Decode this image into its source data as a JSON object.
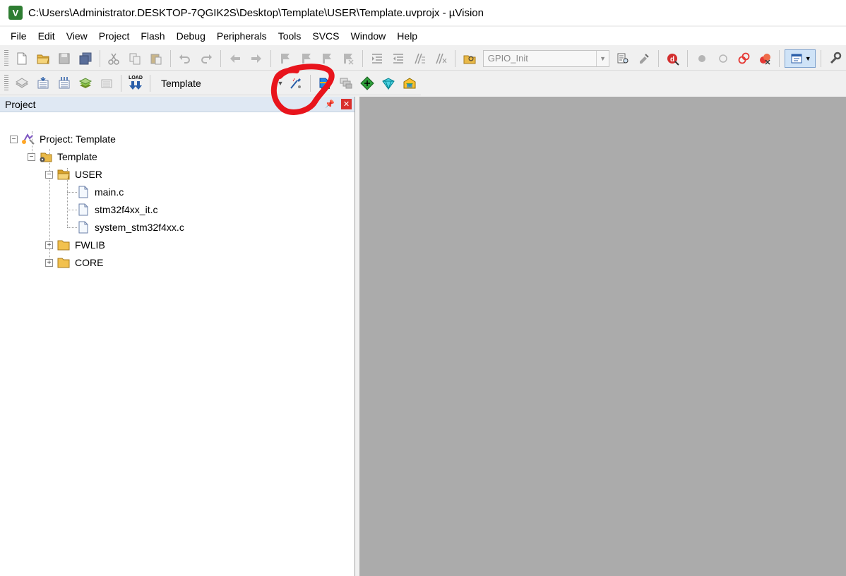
{
  "window": {
    "title": "C:\\Users\\Administrator.DESKTOP-7QGIK2S\\Desktop\\Template\\USER\\Template.uvprojx - µVision",
    "app_icon": "uvision-logo-icon"
  },
  "menu": {
    "items": [
      "File",
      "Edit",
      "View",
      "Project",
      "Flash",
      "Debug",
      "Peripherals",
      "Tools",
      "SVCS",
      "Window",
      "Help"
    ]
  },
  "toolbar1": {
    "function_combo_value": "GPIO_Init",
    "icons": [
      "new-file-icon",
      "open-file-icon",
      "save-icon",
      "save-all-icon",
      "cut-icon",
      "copy-icon",
      "paste-icon",
      "undo-icon",
      "redo-icon",
      "navigate-back-icon",
      "navigate-forward-icon",
      "insert-bookmark-icon",
      "previous-bookmark-icon",
      "next-bookmark-icon",
      "clear-bookmarks-icon",
      "indent-icon",
      "unindent-icon",
      "comment-icon",
      "uncomment-icon",
      "find-in-files-icon",
      "find-icon",
      "incremental-find-icon",
      "debug-session-icon",
      "breakpoint-icon",
      "disable-breakpoint-icon",
      "disable-all-breakpoints-icon",
      "kill-all-breakpoints-icon",
      "window-config-icon",
      "configure-icon"
    ]
  },
  "toolbar2": {
    "target_combo_value": "Template",
    "icons": [
      "translate-icon",
      "build-icon",
      "rebuild-icon",
      "batch-build-icon",
      "stop-build-icon",
      "load-download-icon",
      "options-for-target-icon",
      "file-extensions-icon",
      "manage-multi-project-icon",
      "manage-run-time-environment-icon",
      "select-software-packs-icon",
      "pack-installer-icon"
    ],
    "load_label": "LOAD"
  },
  "project_panel": {
    "title": "Project",
    "tree": {
      "root": "Project: Template",
      "target": "Template",
      "groups": [
        {
          "name": "USER",
          "expanded": true,
          "files": [
            "main.c",
            "stm32f4xx_it.c",
            "system_stm32f4xx.c"
          ]
        },
        {
          "name": "FWLIB",
          "expanded": false,
          "files": []
        },
        {
          "name": "CORE",
          "expanded": false,
          "files": []
        }
      ]
    }
  },
  "colors": {
    "editor_background": "#ababab",
    "panel_header": "#dfe8f3",
    "annotation": "#e8141c",
    "close_button": "#d9302c"
  }
}
